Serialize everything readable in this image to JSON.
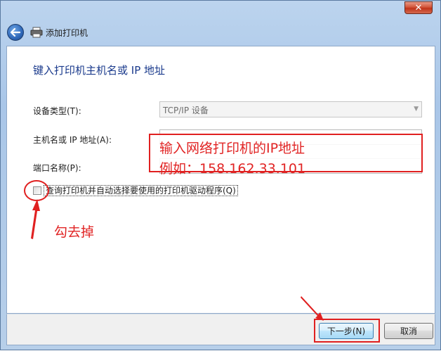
{
  "window": {
    "title": "添加打印机",
    "close_glyph": "✕"
  },
  "nav": {
    "back_icon": "back-arrow-icon",
    "printer_icon": "printer-icon"
  },
  "page": {
    "heading": "键入打印机主机名或 IP 地址"
  },
  "form": {
    "device_type_label": "设备类型(T):",
    "device_type_value": "TCP/IP 设备",
    "host_label": "主机名或 IP 地址(A):",
    "host_value": "",
    "port_label": "端口名称(P):",
    "port_value": "",
    "query_checkbox_label": "查询打印机并自动选择要使用的打印机驱动程序(Q)",
    "query_checked": false
  },
  "annotations": {
    "line1": "输入网络打印机的IP地址",
    "line2": "例如：158.162.33.101",
    "uncheck_hint": "勾去掉",
    "color": "#e12424"
  },
  "footer": {
    "next_label": "下一步(N)",
    "cancel_label": "取消"
  }
}
